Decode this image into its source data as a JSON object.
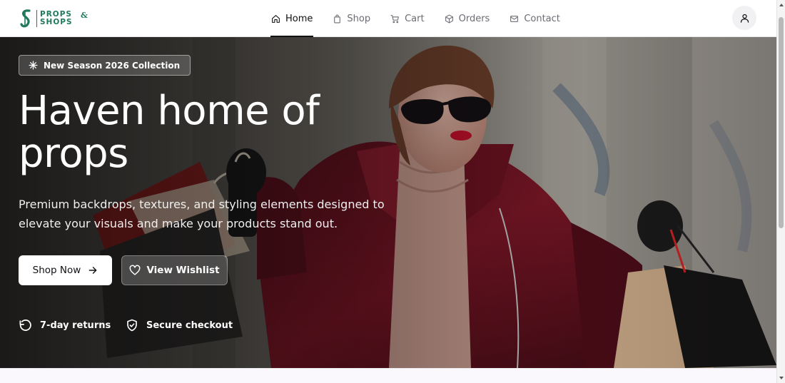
{
  "brand": {
    "line1": "PROPS",
    "line2": "SHOPS",
    "amp": "&"
  },
  "nav": [
    {
      "label": "Home",
      "icon": "home-icon",
      "active": true
    },
    {
      "label": "Shop",
      "icon": "bag-icon",
      "active": false
    },
    {
      "label": "Cart",
      "icon": "cart-icon",
      "active": false
    },
    {
      "label": "Orders",
      "icon": "box-icon",
      "active": false
    },
    {
      "label": "Contact",
      "icon": "mail-icon",
      "active": false
    }
  ],
  "user": {
    "icon": "user-icon"
  },
  "hero": {
    "badge": "New Season 2026 Collection",
    "badge_icon": "sparkle-icon",
    "title": "Haven home of props",
    "subtitle": "Premium backdrops, textures, and styling elements designed to elevate your visuals and make your products stand out.",
    "primary_button": "Shop Now",
    "secondary_button": "View Wishlist",
    "features": [
      {
        "label": "7-day returns",
        "icon": "rotate-ccw-icon"
      },
      {
        "label": "Secure checkout",
        "icon": "shield-check-icon"
      }
    ]
  },
  "colors": {
    "brand": "#1f7a5a",
    "text": "#111114",
    "muted": "#6b6b74",
    "coat": "#6e1422"
  }
}
